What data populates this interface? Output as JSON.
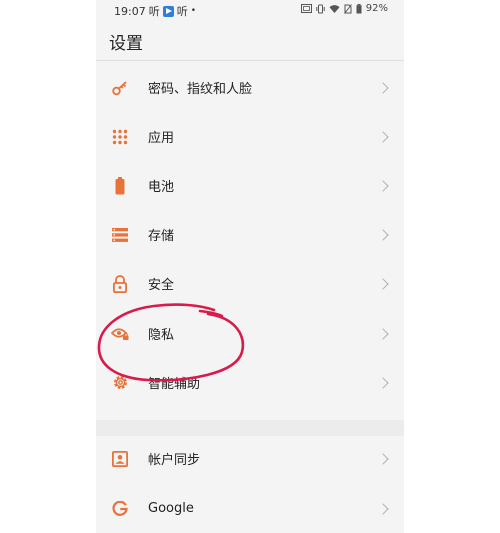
{
  "status_bar": {
    "time": "19:07",
    "left_glyph_1": "听",
    "left_glyph_2": "听",
    "dot": "•",
    "battery": "92%"
  },
  "header": {
    "title": "设置"
  },
  "settings": {
    "items": [
      {
        "label": "密码、指纹和人脸",
        "icon": "key-icon"
      },
      {
        "label": "应用",
        "icon": "apps-grid-icon"
      },
      {
        "label": "电池",
        "icon": "battery-icon"
      },
      {
        "label": "存储",
        "icon": "storage-icon"
      },
      {
        "label": "安全",
        "icon": "lock-icon"
      },
      {
        "label": "隐私",
        "icon": "privacy-eye-icon"
      },
      {
        "label": "智能辅助",
        "icon": "gear-icon"
      }
    ],
    "items2": [
      {
        "label": "帐户同步",
        "icon": "account-icon"
      },
      {
        "label": "Google",
        "icon": "google-icon"
      }
    ]
  },
  "colors": {
    "accent": "#e8733a",
    "annotation": "#d81b4a"
  }
}
